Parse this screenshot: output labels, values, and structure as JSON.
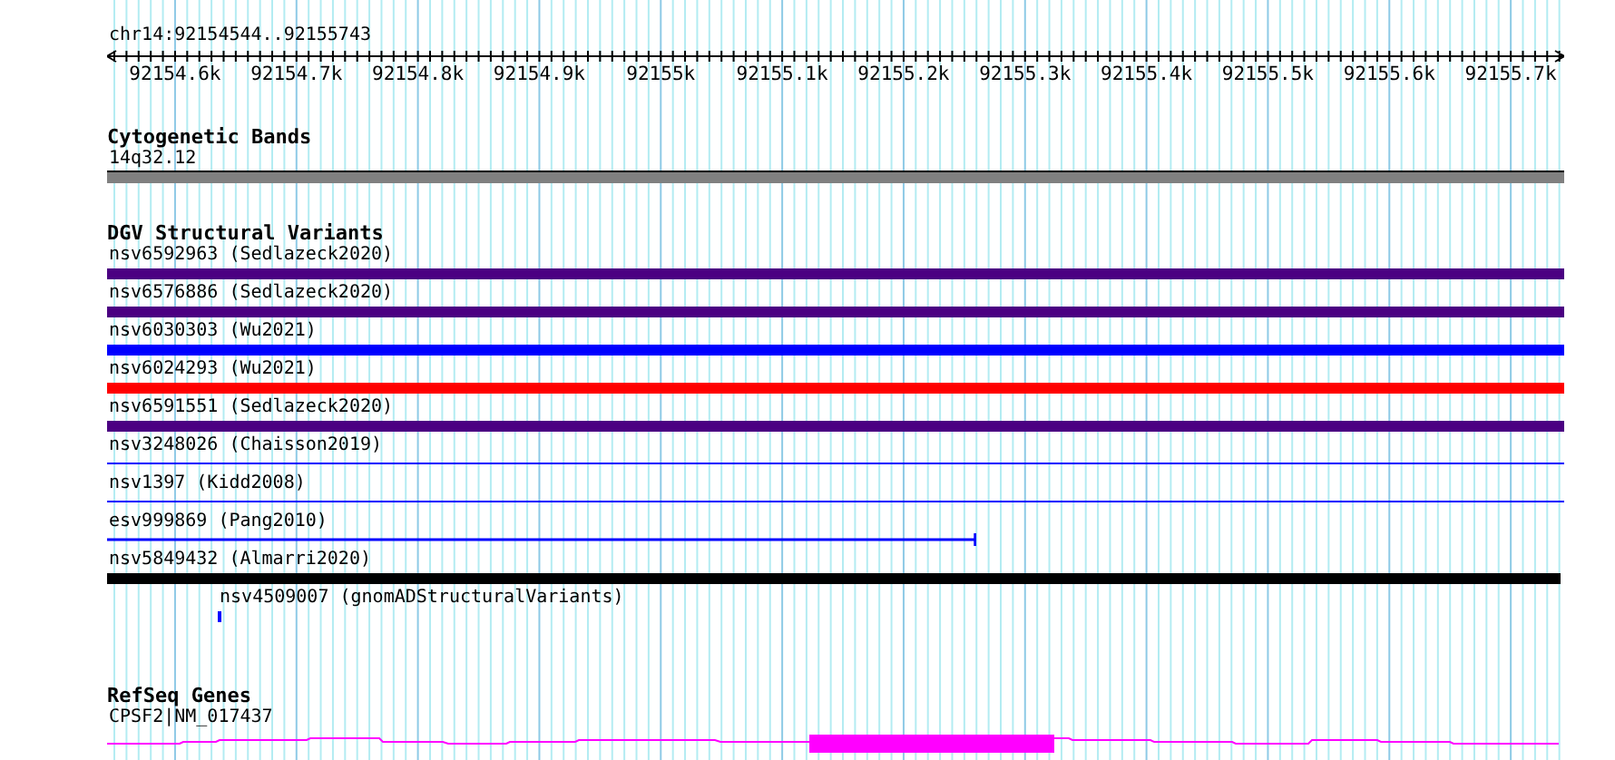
{
  "ruler": {
    "location": "chr14:92154544..92155743",
    "ticks": [
      "92154.6k",
      "92154.7k",
      "92154.8k",
      "92154.9k",
      "92155k",
      "92155.1k",
      "92155.2k",
      "92155.3k",
      "92155.4k",
      "92155.5k",
      "92155.6k",
      "92155.7k"
    ]
  },
  "cytobands": {
    "title": "Cytogenetic Bands",
    "band": "14q32.12"
  },
  "variants": {
    "title": "DGV Structural Variants",
    "items": [
      {
        "label": "nsv6592963 (Sedlazeck2020)",
        "kind": "bar",
        "color": "#4b0082"
      },
      {
        "label": "nsv6576886 (Sedlazeck2020)",
        "kind": "bar",
        "color": "#4b0082"
      },
      {
        "label": "nsv6030303 (Wu2021)",
        "kind": "bar",
        "color": "#0000ff"
      },
      {
        "label": "nsv6024293 (Wu2021)",
        "kind": "bar",
        "color": "#ff0000"
      },
      {
        "label": "nsv6591551 (Sedlazeck2020)",
        "kind": "bar",
        "color": "#4b0082"
      },
      {
        "label": "nsv3248026 (Chaisson2019)",
        "kind": "line",
        "color": "#0000ff"
      },
      {
        "label": "nsv1397 (Kidd2008)",
        "kind": "line",
        "color": "#0000ff"
      },
      {
        "label": "esv999869 (Pang2010)",
        "kind": "line",
        "color": "#0000ff"
      },
      {
        "label": "nsv5849432 (Almarri2020)",
        "kind": "bar",
        "color": "#000000"
      },
      {
        "label": "nsv4509007 (gnomADStructuralVariants)",
        "kind": "bar",
        "color": "#0000ff"
      }
    ]
  },
  "genes": {
    "title": "RefSeq Genes",
    "label": "CPSF2|NM_017437"
  }
}
